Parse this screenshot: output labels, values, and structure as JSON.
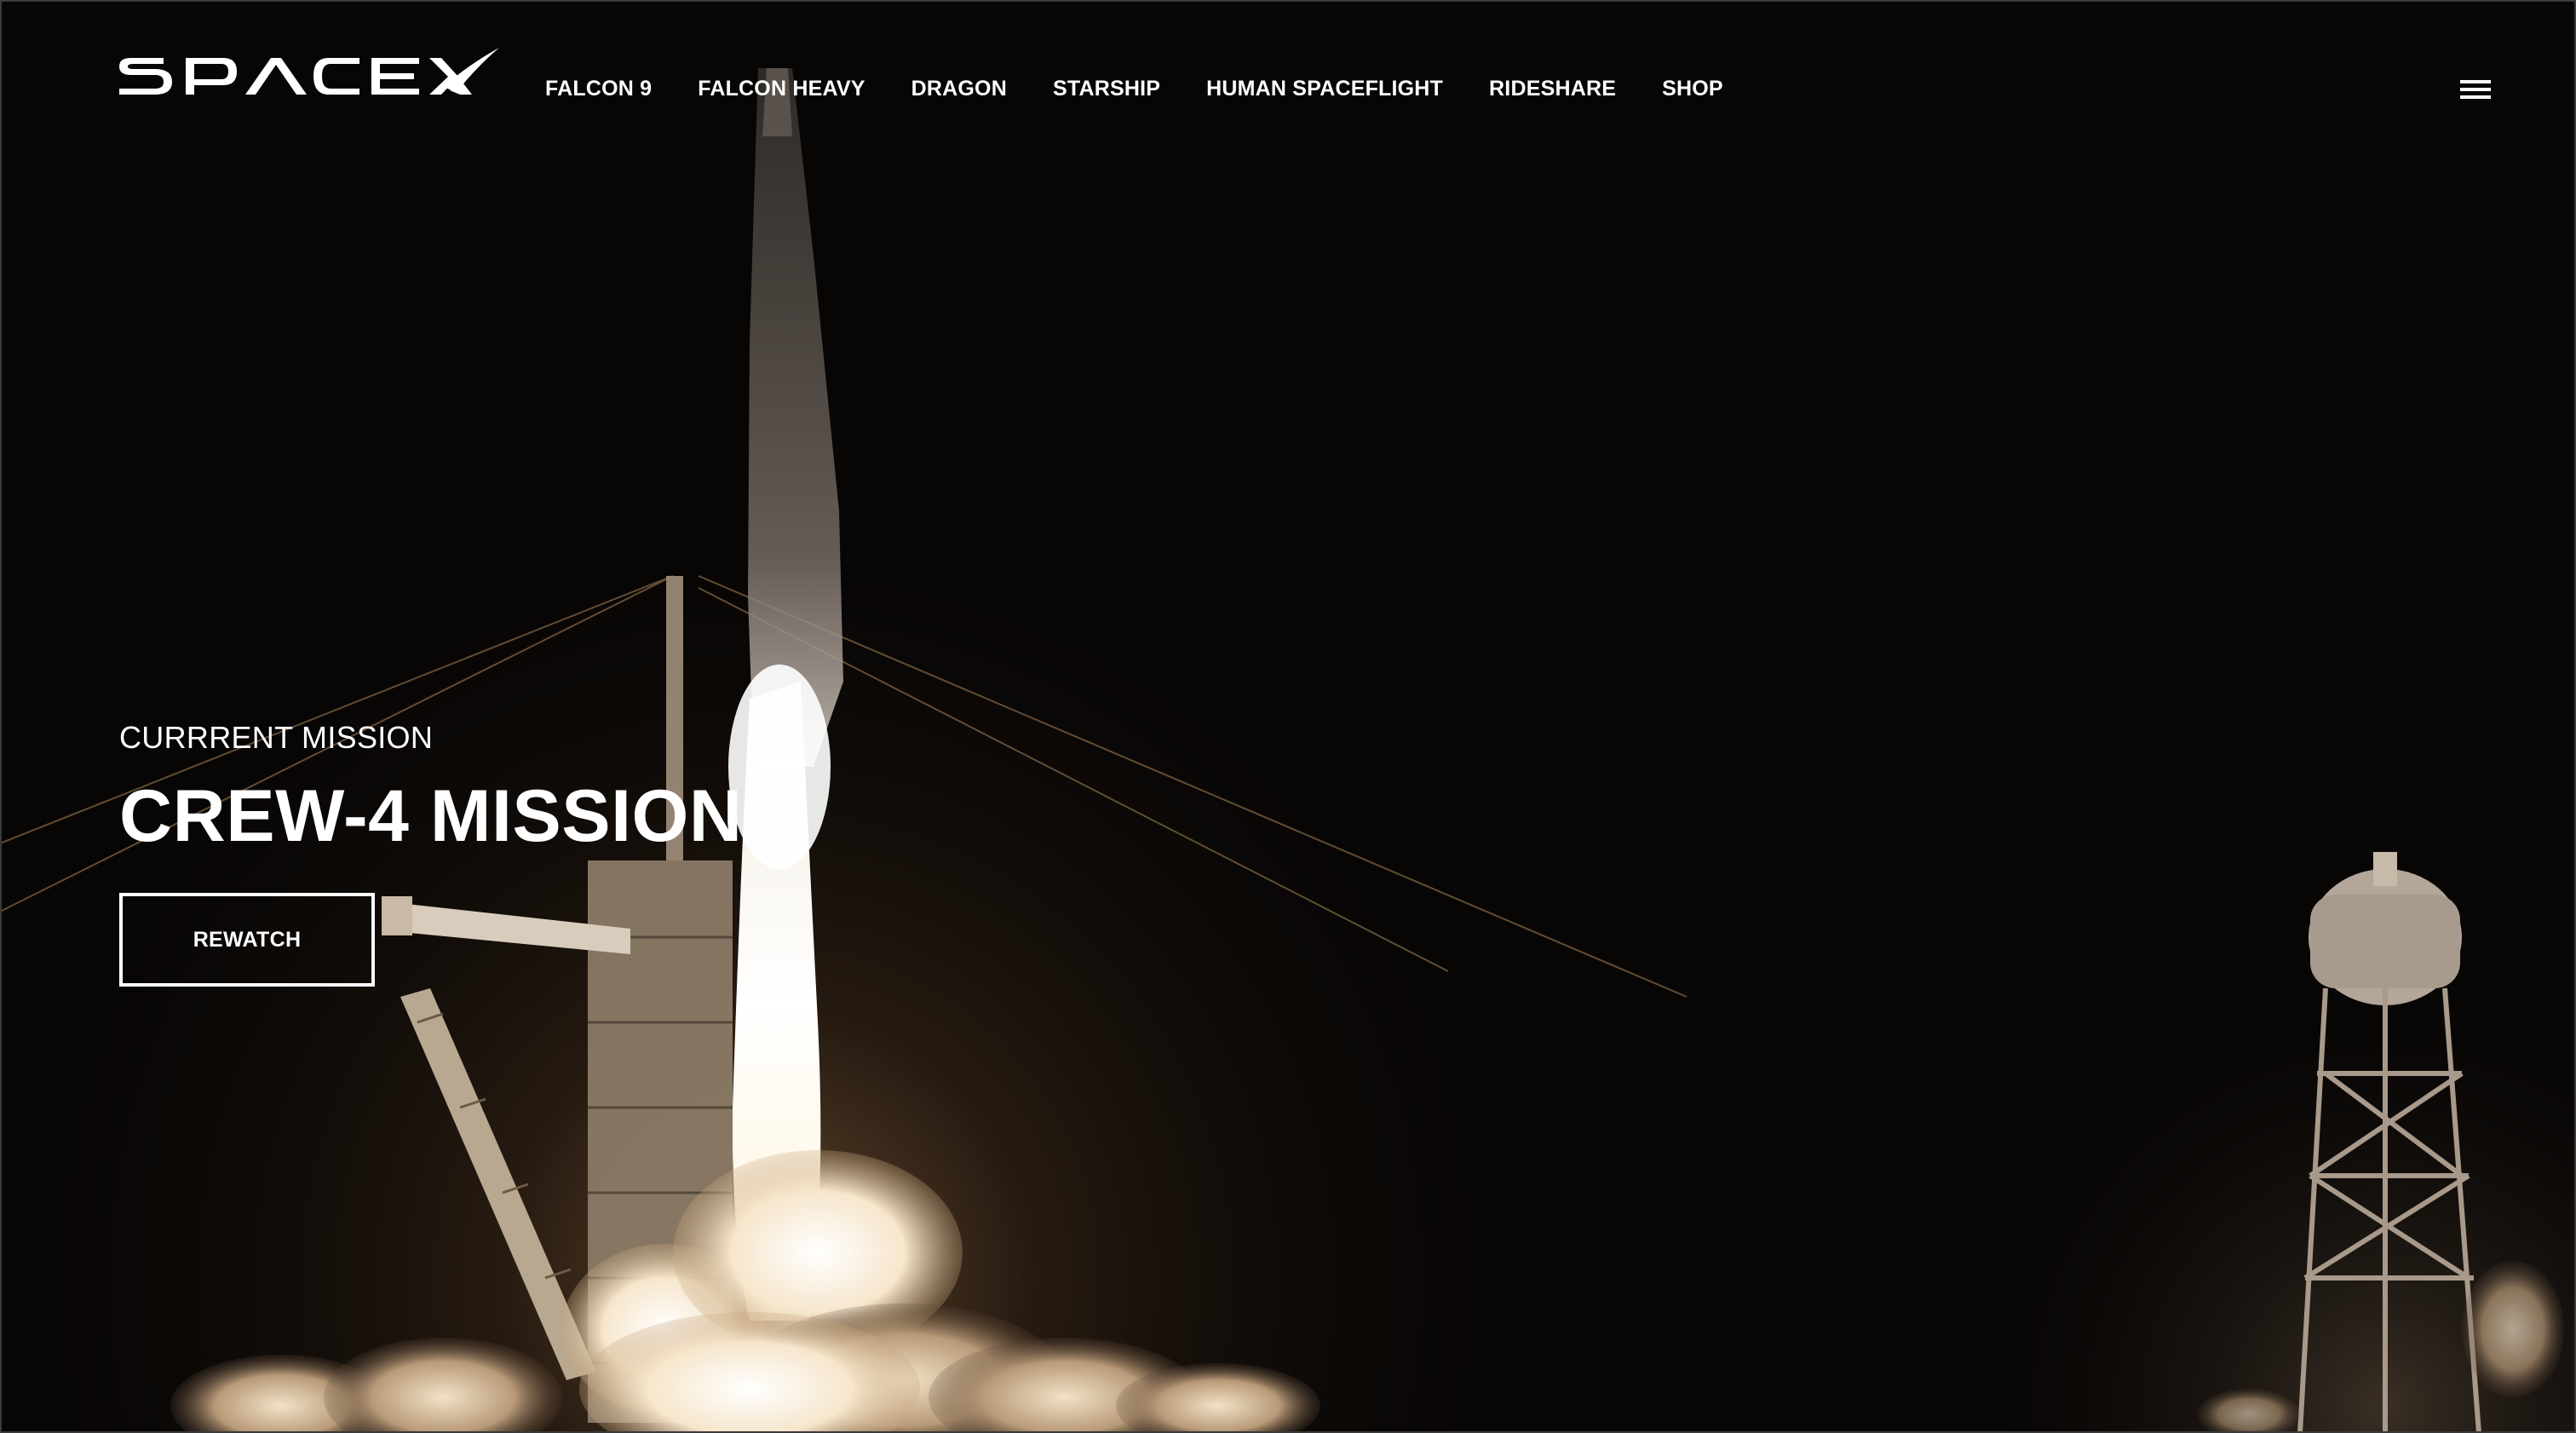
{
  "brand": {
    "logo_text": "SPACEX",
    "logo_icon": "spacex-logo"
  },
  "nav": {
    "items": [
      {
        "label": "FALCON 9"
      },
      {
        "label": "FALCON HEAVY"
      },
      {
        "label": "DRAGON"
      },
      {
        "label": "STARSHIP"
      },
      {
        "label": "HUMAN SPACEFLIGHT"
      },
      {
        "label": "RIDESHARE"
      },
      {
        "label": "SHOP"
      }
    ],
    "menu_icon": "hamburger-menu-icon"
  },
  "hero": {
    "eyebrow": "CURRRENT MISSION",
    "title": "CREW-4 MISSION",
    "cta_label": "REWATCH",
    "image_subject": "night rocket launch from launch tower with water tower"
  },
  "colors": {
    "background": "#080605",
    "text": "#ffffff",
    "accent": "#ffffff"
  }
}
